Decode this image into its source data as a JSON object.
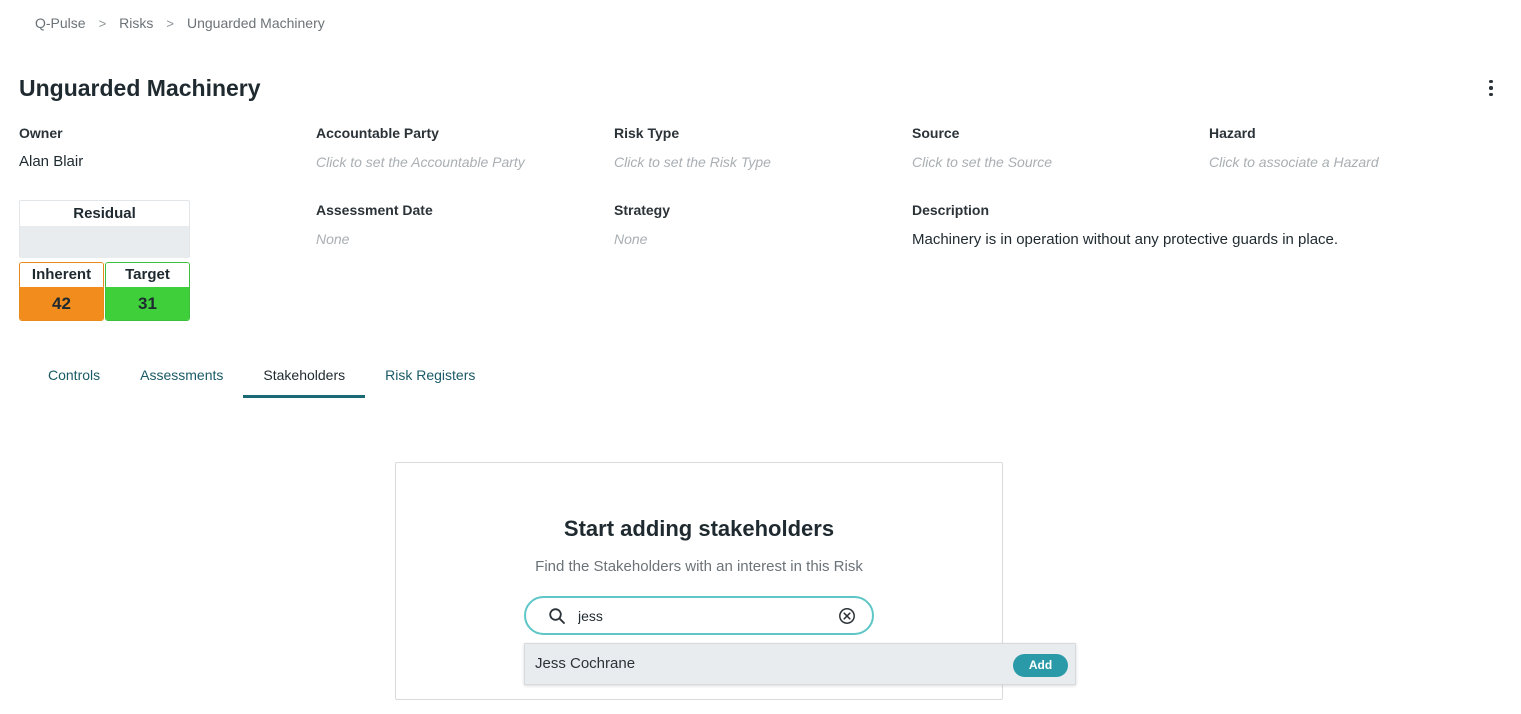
{
  "breadcrumb": {
    "items": [
      "Q-Pulse",
      "Risks",
      "Unguarded Machinery"
    ],
    "separator": ">"
  },
  "page": {
    "title": "Unguarded Machinery"
  },
  "fields": {
    "owner": {
      "label": "Owner",
      "value": "Alan Blair"
    },
    "accountable_party": {
      "label": "Accountable Party",
      "placeholder": "Click to set the Accountable Party"
    },
    "risk_type": {
      "label": "Risk Type",
      "placeholder": "Click to set the Risk Type"
    },
    "source": {
      "label": "Source",
      "placeholder": "Click to set the Source"
    },
    "hazard": {
      "label": "Hazard",
      "placeholder": "Click to associate a Hazard"
    },
    "assessment_date": {
      "label": "Assessment Date",
      "value": "None"
    },
    "strategy": {
      "label": "Strategy",
      "value": "None"
    },
    "description": {
      "label": "Description",
      "value": "Machinery is in operation without any protective guards in place."
    }
  },
  "risk_scores": {
    "residual": {
      "label": "Residual",
      "value": ""
    },
    "inherent": {
      "label": "Inherent",
      "value": "42",
      "color": "#f28c1c"
    },
    "target": {
      "label": "Target",
      "value": "31",
      "color": "#3fcf3a"
    }
  },
  "tabs": [
    {
      "label": "Controls",
      "active": false
    },
    {
      "label": "Assessments",
      "active": false
    },
    {
      "label": "Stakeholders",
      "active": true
    },
    {
      "label": "Risk Registers",
      "active": false
    }
  ],
  "stakeholders_panel": {
    "title": "Start adding stakeholders",
    "subtitle": "Find the Stakeholders with an interest in this Risk",
    "search": {
      "value": "jess",
      "icon": "search-icon",
      "clear_icon": "clear-icon"
    },
    "results": [
      {
        "name": "Jess Cochrane",
        "action_label": "Add"
      }
    ]
  },
  "colors": {
    "accent": "#2b9aa8",
    "tab_active_underline": "#1a6a76",
    "search_border": "#5ec6c6"
  }
}
